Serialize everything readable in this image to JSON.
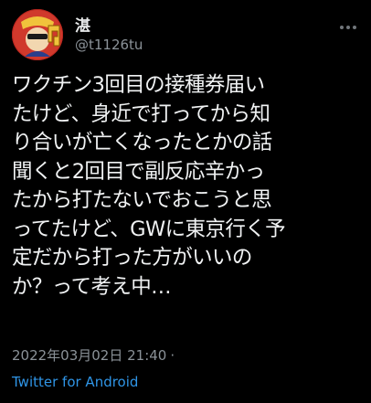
{
  "tweet": {
    "display_name": "湛",
    "handle": "@t1126tu",
    "body_lines": [
      "ワクチン3回目の接種券届い",
      "たけど、身近で打ってから知",
      "り合いが亡くなったとかの話",
      "聞くと2回目で副反応辛かっ",
      "たから打たないでおこうと思",
      "ってたけど、GWに東京行く予",
      "定だから打った方がいいの",
      "か？って考え中…"
    ],
    "timestamp": "2022年03月02日 21:40",
    "separator": "·",
    "source": "Twitter for Android"
  },
  "icons": {
    "avatar": "avatar-image",
    "more": "more-options-icon"
  },
  "colors": {
    "background": "#000000",
    "text": "#e7e9ea",
    "secondary": "#8b9298",
    "link": "#2f95e6"
  }
}
